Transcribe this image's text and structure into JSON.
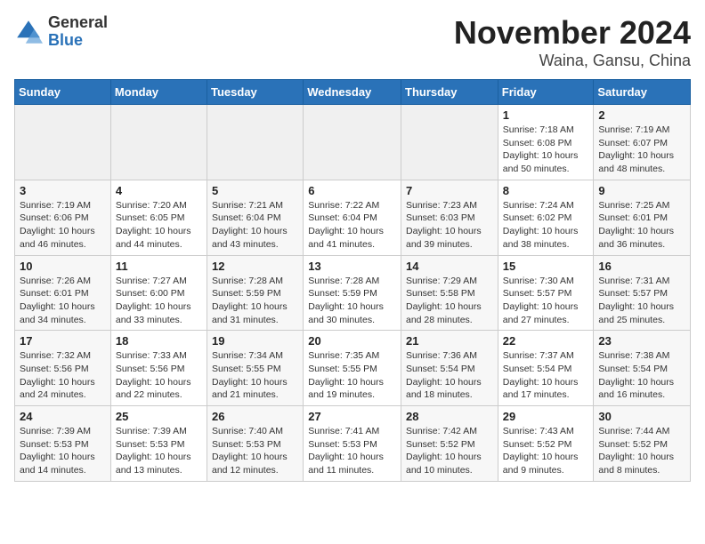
{
  "header": {
    "logo": {
      "general": "General",
      "blue": "Blue"
    },
    "title": "November 2024",
    "subtitle": "Waina, Gansu, China"
  },
  "weekdays": [
    "Sunday",
    "Monday",
    "Tuesday",
    "Wednesday",
    "Thursday",
    "Friday",
    "Saturday"
  ],
  "weeks": [
    [
      {
        "day": "",
        "info": ""
      },
      {
        "day": "",
        "info": ""
      },
      {
        "day": "",
        "info": ""
      },
      {
        "day": "",
        "info": ""
      },
      {
        "day": "",
        "info": ""
      },
      {
        "day": "1",
        "info": "Sunrise: 7:18 AM\nSunset: 6:08 PM\nDaylight: 10 hours\nand 50 minutes."
      },
      {
        "day": "2",
        "info": "Sunrise: 7:19 AM\nSunset: 6:07 PM\nDaylight: 10 hours\nand 48 minutes."
      }
    ],
    [
      {
        "day": "3",
        "info": "Sunrise: 7:19 AM\nSunset: 6:06 PM\nDaylight: 10 hours\nand 46 minutes."
      },
      {
        "day": "4",
        "info": "Sunrise: 7:20 AM\nSunset: 6:05 PM\nDaylight: 10 hours\nand 44 minutes."
      },
      {
        "day": "5",
        "info": "Sunrise: 7:21 AM\nSunset: 6:04 PM\nDaylight: 10 hours\nand 43 minutes."
      },
      {
        "day": "6",
        "info": "Sunrise: 7:22 AM\nSunset: 6:04 PM\nDaylight: 10 hours\nand 41 minutes."
      },
      {
        "day": "7",
        "info": "Sunrise: 7:23 AM\nSunset: 6:03 PM\nDaylight: 10 hours\nand 39 minutes."
      },
      {
        "day": "8",
        "info": "Sunrise: 7:24 AM\nSunset: 6:02 PM\nDaylight: 10 hours\nand 38 minutes."
      },
      {
        "day": "9",
        "info": "Sunrise: 7:25 AM\nSunset: 6:01 PM\nDaylight: 10 hours\nand 36 minutes."
      }
    ],
    [
      {
        "day": "10",
        "info": "Sunrise: 7:26 AM\nSunset: 6:01 PM\nDaylight: 10 hours\nand 34 minutes."
      },
      {
        "day": "11",
        "info": "Sunrise: 7:27 AM\nSunset: 6:00 PM\nDaylight: 10 hours\nand 33 minutes."
      },
      {
        "day": "12",
        "info": "Sunrise: 7:28 AM\nSunset: 5:59 PM\nDaylight: 10 hours\nand 31 minutes."
      },
      {
        "day": "13",
        "info": "Sunrise: 7:28 AM\nSunset: 5:59 PM\nDaylight: 10 hours\nand 30 minutes."
      },
      {
        "day": "14",
        "info": "Sunrise: 7:29 AM\nSunset: 5:58 PM\nDaylight: 10 hours\nand 28 minutes."
      },
      {
        "day": "15",
        "info": "Sunrise: 7:30 AM\nSunset: 5:57 PM\nDaylight: 10 hours\nand 27 minutes."
      },
      {
        "day": "16",
        "info": "Sunrise: 7:31 AM\nSunset: 5:57 PM\nDaylight: 10 hours\nand 25 minutes."
      }
    ],
    [
      {
        "day": "17",
        "info": "Sunrise: 7:32 AM\nSunset: 5:56 PM\nDaylight: 10 hours\nand 24 minutes."
      },
      {
        "day": "18",
        "info": "Sunrise: 7:33 AM\nSunset: 5:56 PM\nDaylight: 10 hours\nand 22 minutes."
      },
      {
        "day": "19",
        "info": "Sunrise: 7:34 AM\nSunset: 5:55 PM\nDaylight: 10 hours\nand 21 minutes."
      },
      {
        "day": "20",
        "info": "Sunrise: 7:35 AM\nSunset: 5:55 PM\nDaylight: 10 hours\nand 19 minutes."
      },
      {
        "day": "21",
        "info": "Sunrise: 7:36 AM\nSunset: 5:54 PM\nDaylight: 10 hours\nand 18 minutes."
      },
      {
        "day": "22",
        "info": "Sunrise: 7:37 AM\nSunset: 5:54 PM\nDaylight: 10 hours\nand 17 minutes."
      },
      {
        "day": "23",
        "info": "Sunrise: 7:38 AM\nSunset: 5:54 PM\nDaylight: 10 hours\nand 16 minutes."
      }
    ],
    [
      {
        "day": "24",
        "info": "Sunrise: 7:39 AM\nSunset: 5:53 PM\nDaylight: 10 hours\nand 14 minutes."
      },
      {
        "day": "25",
        "info": "Sunrise: 7:39 AM\nSunset: 5:53 PM\nDaylight: 10 hours\nand 13 minutes."
      },
      {
        "day": "26",
        "info": "Sunrise: 7:40 AM\nSunset: 5:53 PM\nDaylight: 10 hours\nand 12 minutes."
      },
      {
        "day": "27",
        "info": "Sunrise: 7:41 AM\nSunset: 5:53 PM\nDaylight: 10 hours\nand 11 minutes."
      },
      {
        "day": "28",
        "info": "Sunrise: 7:42 AM\nSunset: 5:52 PM\nDaylight: 10 hours\nand 10 minutes."
      },
      {
        "day": "29",
        "info": "Sunrise: 7:43 AM\nSunset: 5:52 PM\nDaylight: 10 hours\nand 9 minutes."
      },
      {
        "day": "30",
        "info": "Sunrise: 7:44 AM\nSunset: 5:52 PM\nDaylight: 10 hours\nand 8 minutes."
      }
    ]
  ]
}
